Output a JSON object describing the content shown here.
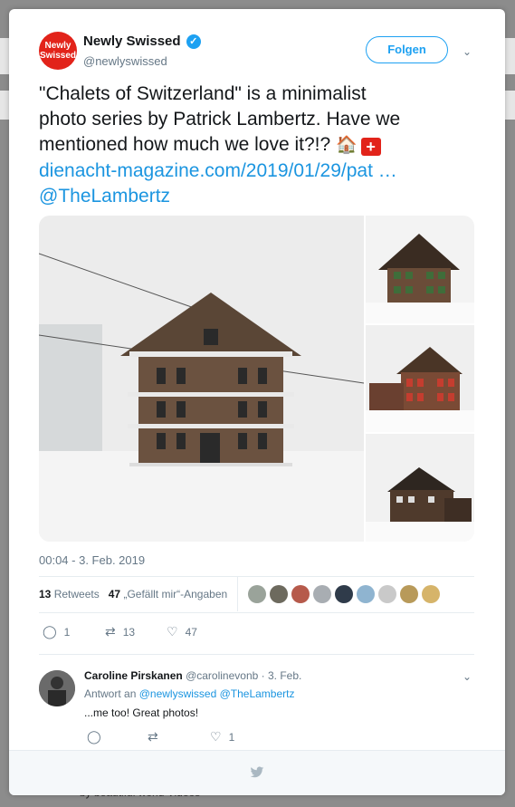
{
  "tweet": {
    "author_name": "Newly Swissed",
    "author_handle": "@newlyswissed",
    "avatar_text": "Newly Swissed",
    "follow_label": "Folgen",
    "text_line1": "\"Chalets of Switzerland\" is a minimalist",
    "text_line2": "photo series by Patrick Lambertz. Have we",
    "text_line3": "mentioned how much we love it?!? ",
    "link_url": "dienacht-magazine.com/2019/01/29/pat …",
    "mention": "@TheLambertz",
    "timestamp": "00:04 - 3. Feb. 2019",
    "retweets_count": "13",
    "retweets_label": "Retweets",
    "likes_count": "47",
    "likes_label": "„Gefällt mir“-Angaben",
    "action_replies": "1",
    "action_retweets": "13",
    "action_likes": "47"
  },
  "reply": {
    "name": "Caroline Pirskanen",
    "handle": "@carolinevonb",
    "date": "· 3. Feb.",
    "reply_to_prefix": "Antwort an",
    "reply_to_mentions": "@newlyswissed @TheLambertz",
    "text": "...me too! Great photos!",
    "likes": "1"
  },
  "background": {
    "footer_text": "by beautiful world Videos"
  },
  "icons": {
    "verified": "verified-badge-icon",
    "house": "house-emoji-icon",
    "flag": "swiss-flag-emoji-icon",
    "reply": "reply-icon",
    "retweet": "retweet-icon",
    "like": "heart-icon",
    "twitter": "twitter-bird-icon"
  },
  "colors": {
    "accent": "#1da1f2",
    "link": "#1b95e0",
    "muted": "#657786",
    "brand_red": "#e2231a"
  }
}
